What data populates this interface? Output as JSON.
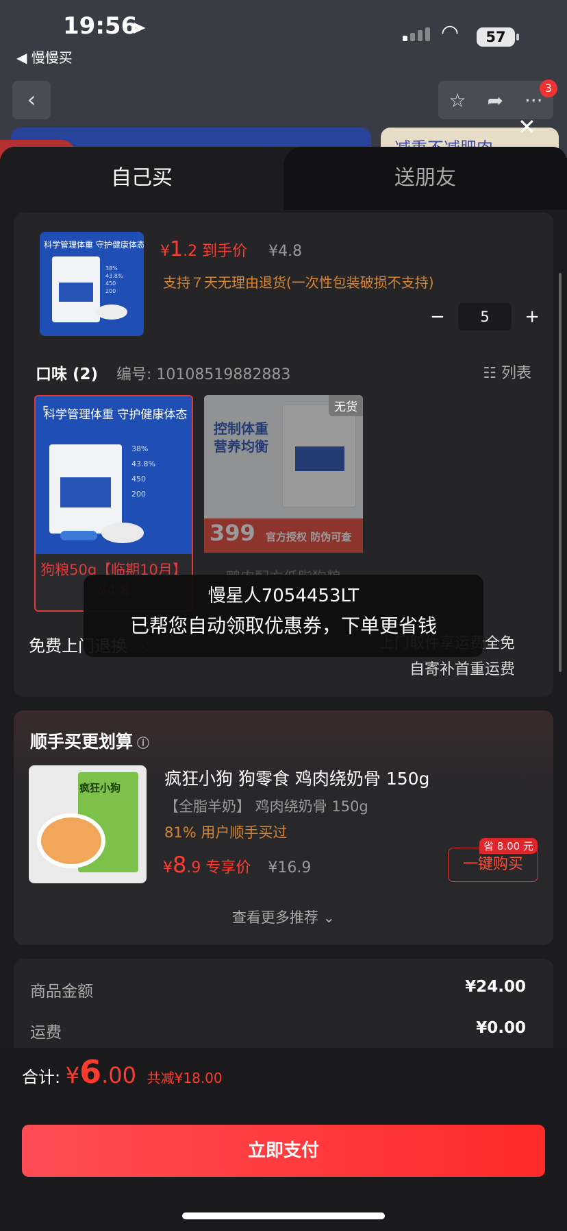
{
  "status_bar": {
    "time": "19:56",
    "back_app": "◀ 慢慢买",
    "battery": "57"
  },
  "nav": {
    "badge_count": "3",
    "banner_right_text": "减重不减肥肉"
  },
  "tabs": [
    {
      "label": "自己买"
    },
    {
      "label": "送朋友"
    }
  ],
  "product": {
    "image_caption": "科学管理体重 守护健康体态",
    "price_currency": "¥",
    "price_int": "1",
    "price_dec": ".2",
    "price_label": "到手价",
    "original_price": "¥4.8",
    "return_note": "支持７天无理由退货(一次性包装破损不支持)",
    "quantity": "5",
    "minus": "−",
    "plus": "+"
  },
  "flavor": {
    "label": "口味 (2)",
    "code": "编号: 10108519882883",
    "list_label": "列表",
    "options": [
      {
        "name": "狗粮50g【临期10月】 ¥4.8",
        "image_caption": "科学管理体重 守护健康体态",
        "selected": true
      },
      {
        "name": "鸭肉配方低脂狗粮",
        "image_caption": "控制体重 营养均衡",
        "badge": "无货",
        "price_tag": "399",
        "tag_text": "官方授权 防伪可查"
      }
    ]
  },
  "returns": {
    "label": "免费上门退换",
    "right_line1": "上门取件享运费全免",
    "right_line2": "自寄补首重运费"
  },
  "toast": {
    "user": "慢星人7054453LT",
    "message": "已帮您自动领取优惠券，下单更省钱"
  },
  "addon": {
    "title": "顺手买更划算",
    "item": {
      "name": "疯狂小狗 狗零食 鸡肉绕奶骨 150g",
      "spec": "【全脂羊奶】 鸡肉绕奶骨 150g",
      "social": "81% 用户顺手买过",
      "price_currency": "¥",
      "price_int": "8",
      "price_dec": ".9",
      "price_label": "专享价",
      "original_price": "¥16.9",
      "save_tag": "省 8.00 元",
      "buy_label": "一键购买",
      "brand_text": "疯狂小狗"
    },
    "more_label": "查看更多推荐 ⌄"
  },
  "summary": {
    "rows": [
      {
        "label": "商品金额",
        "value": "¥24.00"
      },
      {
        "label": "运费",
        "value": "¥0.00"
      }
    ]
  },
  "footer": {
    "total_label": "合计:",
    "currency": "¥",
    "amount_int": "6",
    "amount_dec": ".00",
    "discount": "共减¥18.00",
    "pay_label": "立即支付"
  }
}
